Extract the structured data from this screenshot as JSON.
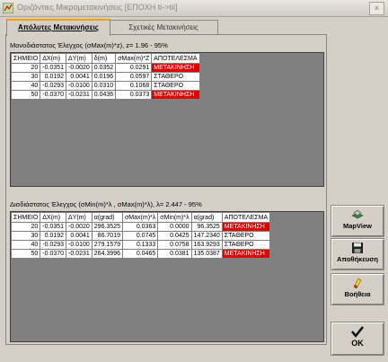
{
  "window": {
    "title": "Οριζόντιες Μικρομετακινήσεις [ΕΠΟΧΗ ti->tii]",
    "close_label": "×"
  },
  "tabs": [
    {
      "label": "Απόλυτες Μετακινήσεις",
      "active": true
    },
    {
      "label": "Σχετικές Μετακινήσεις",
      "active": false
    }
  ],
  "section1": {
    "label": "Μονοδιάστατος Έλεγχος (σMax(m)*z),  z= 1.96 - 95%",
    "columns": [
      "ΣΗΜΕΙΟ",
      "ΔX(m)",
      "ΔY(m)",
      "δ(m)",
      "σMax(m)*Z",
      "ΑΠΟΤΕΛΕΣΜΑ"
    ],
    "rows": [
      {
        "cells": [
          "20",
          "-0.0351",
          "-0.0020",
          "0.0352",
          "0.0291",
          "ΜΕΤΑΚΙΝΗΣΗ"
        ],
        "moving": true
      },
      {
        "cells": [
          "30",
          "0.0192",
          "0.0041",
          "0.0196",
          "0.0597",
          "ΣΤΑΘΕΡΟ"
        ],
        "moving": false
      },
      {
        "cells": [
          "40",
          "-0.0293",
          "-0.0100",
          "0.0310",
          "0.1068",
          "ΣΤΑΘΕΡΟ"
        ],
        "moving": false
      },
      {
        "cells": [
          "50",
          "-0.0370",
          "-0.0231",
          "0.0436",
          "0.0373",
          "ΜΕΤΑΚΙΝΗΣΗ"
        ],
        "moving": true
      }
    ]
  },
  "section2": {
    "label": "Δισδιάστατος Έλεγχος (σMin(m)*λ , σMax(m)*λ),  λ= 2.447 - 95%",
    "columns": [
      "ΣΗΜΕΙΟ",
      "ΔX(m)",
      "ΔY(m)",
      "α(grad)",
      "σMax(m)*λ",
      "σMin(m)*λ",
      "α(grad)",
      "ΑΠΟΤΕΛΕΣΜΑ"
    ],
    "rows": [
      {
        "cells": [
          "20",
          "-0.0351",
          "-0.0020",
          "296.3525",
          "0.0363",
          "0.0000",
          "96.3525",
          "ΜΕΤΑΚΙΝΗΣΗ"
        ],
        "moving": true
      },
      {
        "cells": [
          "30",
          "0.0192",
          "0.0041",
          "86.7019",
          "0.0745",
          "0.0425",
          "147.2340",
          "ΣΤΑΘΕΡΟ"
        ],
        "moving": false
      },
      {
        "cells": [
          "40",
          "-0.0293",
          "-0.0100",
          "279.1579",
          "0.1333",
          "0.0758",
          "163.9293",
          "ΣΤΑΘΕΡΟ"
        ],
        "moving": false
      },
      {
        "cells": [
          "50",
          "-0.0370",
          "-0.0231",
          "264.3996",
          "0.0465",
          "0.0381",
          "135.0387",
          "ΜΕΤΑΚΙΝΗΣΗ"
        ],
        "moving": true
      }
    ]
  },
  "buttons": {
    "mapview": {
      "label": "MapView",
      "icon": "map-icon"
    },
    "save": {
      "label": "Αποθήκευση",
      "icon": "floppy-disk-icon"
    },
    "help": {
      "label": "Βοήθεια",
      "icon": "help-icon"
    },
    "ok": {
      "label": "OK",
      "icon": "checkmark-icon"
    }
  },
  "colors": {
    "moving": "#e00000",
    "grid_background": "#808080",
    "window": "#d4d0c8"
  }
}
